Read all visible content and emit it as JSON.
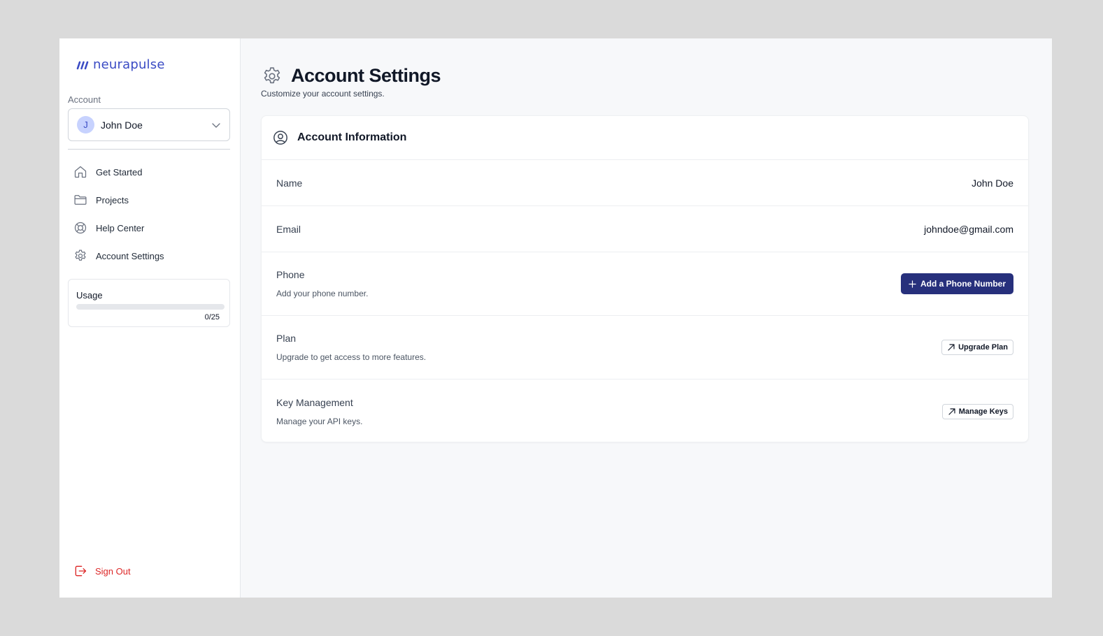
{
  "brand": {
    "name": "neurapulse",
    "color": "#3a4bc4"
  },
  "sidebar": {
    "account_label": "Account",
    "account": {
      "initial": "J",
      "name": "John Doe"
    },
    "items": [
      {
        "label": "Get Started",
        "icon": "home-icon"
      },
      {
        "label": "Projects",
        "icon": "folder-icon"
      },
      {
        "label": "Help Center",
        "icon": "lifebuoy-icon"
      },
      {
        "label": "Account Settings",
        "icon": "gear-icon"
      }
    ],
    "usage": {
      "title": "Usage",
      "used": 0,
      "limit": 25,
      "count_text": "0/25",
      "fraction": 0
    },
    "signout_label": "Sign Out"
  },
  "page": {
    "title": "Account Settings",
    "subtitle": "Customize your account settings."
  },
  "card": {
    "title": "Account Information",
    "rows": {
      "name": {
        "label": "Name",
        "value": "John Doe"
      },
      "email": {
        "label": "Email",
        "value": "johndoe@gmail.com"
      },
      "phone": {
        "label": "Phone",
        "description": "Add your phone number.",
        "button": "Add a Phone Number"
      },
      "plan": {
        "label": "Plan",
        "description": "Upgrade to get access to more features.",
        "button": "Upgrade Plan"
      },
      "keys": {
        "label": "Key Management",
        "description": "Manage your API keys.",
        "button": "Manage Keys"
      }
    }
  },
  "colors": {
    "primary_button": "#27307c",
    "danger": "#dc2626",
    "background": "#f7f8fa"
  }
}
